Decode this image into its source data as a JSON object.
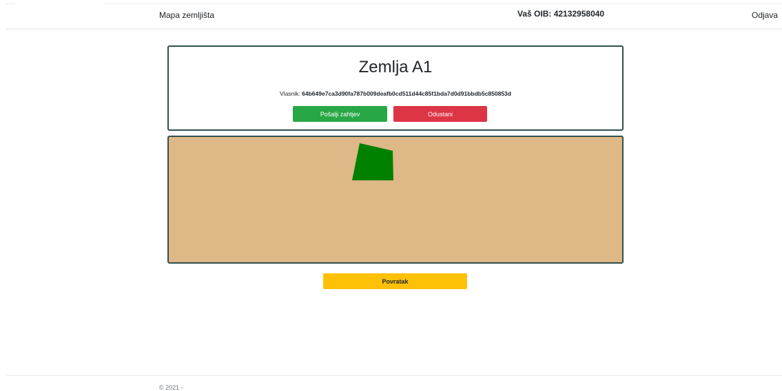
{
  "navbar": {
    "brand": "Mapa zemljišta",
    "oib": "Vaš OIB: 42132958040",
    "logout": "Odjava"
  },
  "card": {
    "title": "Zemlja A1",
    "owner_label": "Vlasnik:",
    "owner_hash": "64b649e7ca3d90fa787b009deafb0cd511d44c85f1bda7d0d91bbdb5c850853d",
    "send_button": "Pošalji zahtjev",
    "cancel_button": "Odustani"
  },
  "map": {
    "background_color": "#deb887",
    "parcel_color": "#008000"
  },
  "back_button": "Povratak",
  "footer": {
    "text": "© 2021 -"
  },
  "colors": {
    "send": "#28a745",
    "cancel": "#dc3545",
    "back": "#ffc107",
    "border": "#2f4f4f"
  }
}
